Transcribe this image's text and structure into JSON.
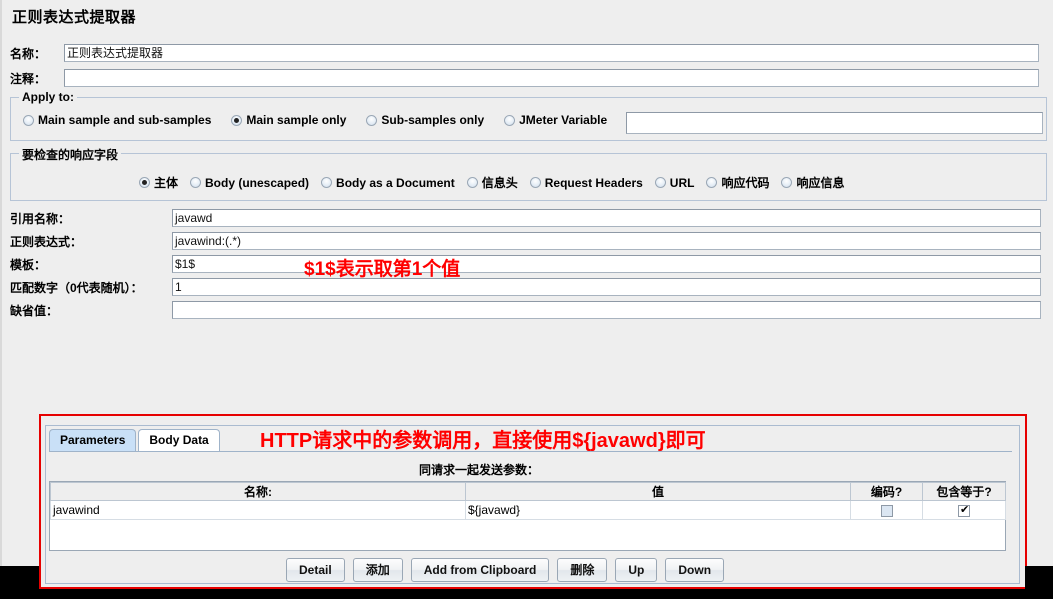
{
  "window": {
    "title": "正则表达式提取器"
  },
  "form": {
    "name_label": "名称：",
    "name_value": "正则表达式提取器",
    "comment_label": "注释：",
    "comment_value": ""
  },
  "apply_to": {
    "title": "Apply to:",
    "options": [
      {
        "label": "Main sample and sub-samples",
        "selected": false
      },
      {
        "label": "Main sample only",
        "selected": true
      },
      {
        "label": "Sub-samples only",
        "selected": false
      },
      {
        "label": "JMeter Variable",
        "selected": false
      }
    ],
    "variable_value": ""
  },
  "response_field": {
    "title": "要检查的响应字段",
    "options": [
      {
        "label": "主体",
        "selected": true
      },
      {
        "label": "Body (unescaped)",
        "selected": false
      },
      {
        "label": "Body as a Document",
        "selected": false
      },
      {
        "label": "信息头",
        "selected": false
      },
      {
        "label": "Request Headers",
        "selected": false
      },
      {
        "label": "URL",
        "selected": false
      },
      {
        "label": "响应代码",
        "selected": false
      },
      {
        "label": "响应信息",
        "selected": false
      }
    ]
  },
  "extractor": {
    "refname_label": "引用名称：",
    "refname_value": "javawd",
    "regex_label": "正则表达式：",
    "regex_value": "javawind:(.*)",
    "template_label": "模板：",
    "template_value": "$1$",
    "matchno_label": "匹配数字（0代表随机）：",
    "matchno_value": "1",
    "default_label": "缺省值：",
    "default_value": ""
  },
  "annotations": {
    "template_note": "$1$表示取第1个值",
    "params_note": "HTTP请求中的参数调用，直接使用${javawd}即可",
    "note_color": "#ff0000"
  },
  "http_panel": {
    "tabs": [
      {
        "label": "Parameters",
        "active": true
      },
      {
        "label": "Body Data",
        "active": false
      }
    ],
    "section_label": "同请求一起发送参数：",
    "table": {
      "headers": [
        "名称:",
        "值",
        "编码?",
        "包含等于?"
      ],
      "rows": [
        {
          "name": "javawind",
          "value": "${javawd}",
          "encode": false,
          "include_equals": true
        }
      ]
    },
    "buttons": [
      "Detail",
      "添加",
      "Add from Clipboard",
      "删除",
      "Up",
      "Down"
    ]
  }
}
